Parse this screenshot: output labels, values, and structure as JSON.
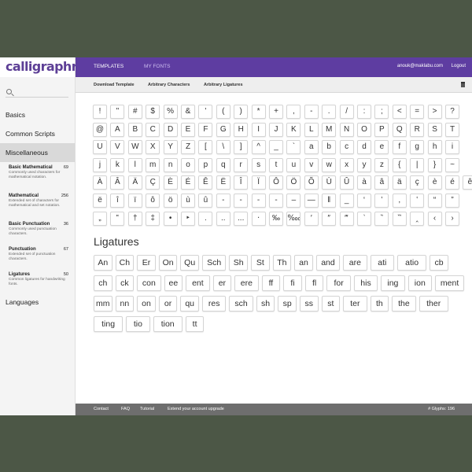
{
  "app": {
    "logo": "calligraphr"
  },
  "topbar": {
    "tabs": [
      "TEMPLATES",
      "MY FONTS"
    ],
    "email": "anouk@maklabu.com",
    "logout": "Logout"
  },
  "subnav": {
    "download": "Download Template",
    "arbitrary_chars": "Arbitrary Characters",
    "arbitrary_ligs": "Arbitrary Ligatures"
  },
  "sidebar": {
    "categories": [
      "Basics",
      "Common Scripts",
      "Miscellaneous",
      "Languages"
    ],
    "subcategories": [
      {
        "title": "Basic Mathematical",
        "count": "69",
        "desc": "Commonly used characters for mathematical notation."
      },
      {
        "title": "Mathematical",
        "count": "256",
        "desc": "Extended set of characters for mathematical and set notation."
      },
      {
        "title": "Basic Punctuation",
        "count": "36",
        "desc": "Commonly used punctuation characters."
      },
      {
        "title": "Punctuation",
        "count": "67",
        "desc": "Extended set of punctuation characters."
      },
      {
        "title": "Ligatures",
        "count": "50",
        "desc": "Common ligatures for handwriting fonts."
      }
    ]
  },
  "glyph_rows": [
    [
      "!",
      "\"",
      "#",
      "$",
      "%",
      "&",
      "'",
      "(",
      ")",
      "*",
      "+",
      ",",
      "-",
      ".",
      "/",
      ":",
      ";",
      "<",
      "=",
      ">",
      "?"
    ],
    [
      "@",
      "A",
      "B",
      "C",
      "D",
      "E",
      "F",
      "G",
      "H",
      "I",
      "J",
      "K",
      "L",
      "M",
      "N",
      "O",
      "P",
      "Q",
      "R",
      "S",
      "T"
    ],
    [
      "U",
      "V",
      "W",
      "X",
      "Y",
      "Z",
      "[",
      "\\",
      "]",
      "^",
      "_",
      "`",
      "a",
      "b",
      "c",
      "d",
      "e",
      "f",
      "g",
      "h",
      "i"
    ],
    [
      "j",
      "k",
      "l",
      "m",
      "n",
      "o",
      "p",
      "q",
      "r",
      "s",
      "t",
      "u",
      "v",
      "w",
      "x",
      "y",
      "z",
      "{",
      "|",
      "}",
      "~"
    ],
    [
      "À",
      "Â",
      "Ä",
      "Ç",
      "È",
      "É",
      "Ê",
      "Ë",
      "Î",
      "Ï",
      "Ô",
      "Ö",
      "Õ",
      "Ù",
      "Û",
      "à",
      "â",
      "ä",
      "ç",
      "è",
      "é",
      "ê"
    ],
    [
      "ë",
      "î",
      "ï",
      "ô",
      "ö",
      "ù",
      "û",
      "-",
      "-",
      "-",
      "-",
      "–",
      "—",
      "‖",
      "_",
      "‘",
      "’",
      ",",
      "‛",
      "“",
      "”"
    ],
    [
      "„",
      "‟",
      "†",
      "‡",
      "•",
      "‣",
      ".",
      "..",
      "...",
      "‧",
      "‰",
      "‱",
      "′",
      "″",
      "‴",
      "‵",
      "‶",
      "‷",
      "‸",
      "‹",
      "›"
    ]
  ],
  "ligatures_title": "Ligatures",
  "ligature_rows": [
    [
      "An",
      "Ch",
      "Er",
      "On",
      "Qu",
      "Sch",
      "Sh",
      "St",
      "Th",
      "an",
      "and",
      "are",
      "ati",
      "atio",
      "cb"
    ],
    [
      "ch",
      "ck",
      "con",
      "ee",
      "ent",
      "er",
      "ere",
      "ff",
      "fi",
      "fl",
      "for",
      "his",
      "ing",
      "ion",
      "ment"
    ],
    [
      "mm",
      "nn",
      "on",
      "or",
      "qu",
      "res",
      "sch",
      "sh",
      "sp",
      "ss",
      "st",
      "ter",
      "th",
      "the",
      "ther"
    ],
    [
      "ting",
      "tio",
      "tion",
      "tt"
    ]
  ],
  "footer": {
    "contact": "Contact",
    "faq": "FAQ",
    "tutorial": "Tutorial",
    "extend": "Extend your account upgrade",
    "glyphs": "# Glyphs: 196"
  }
}
